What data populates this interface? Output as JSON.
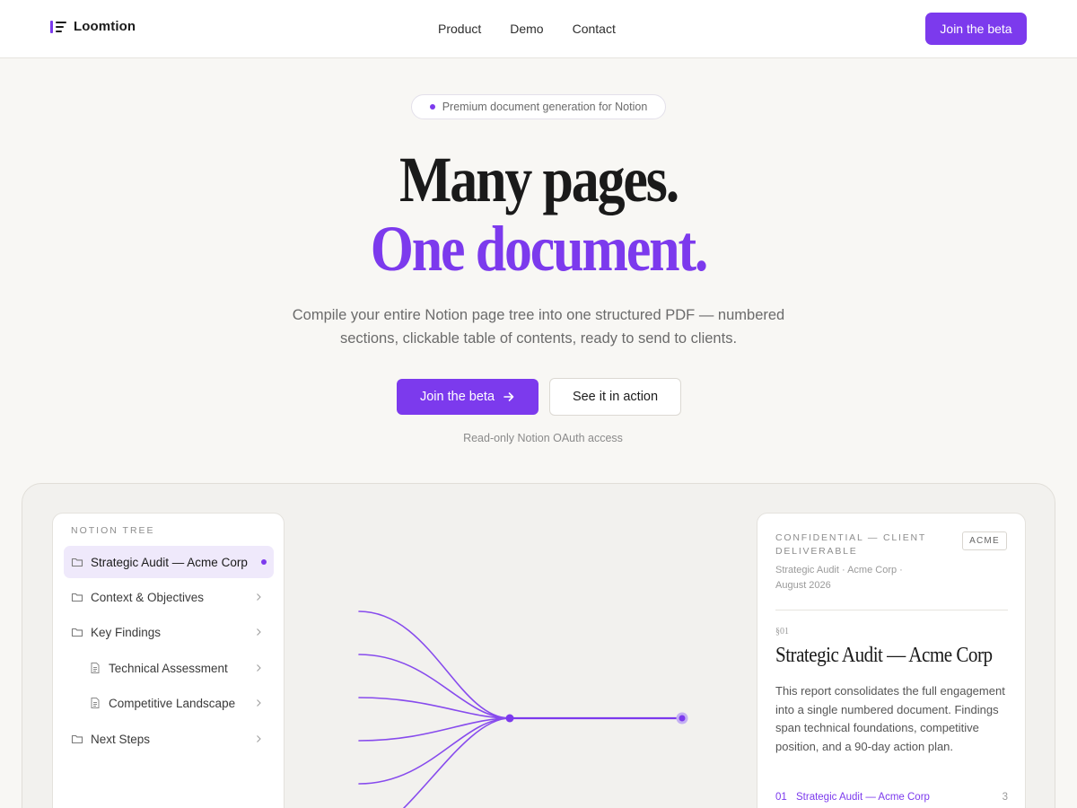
{
  "brand": {
    "name": "Loomtion"
  },
  "nav": {
    "links": [
      "Product",
      "Demo",
      "Contact"
    ],
    "cta": "Join the beta"
  },
  "hero": {
    "pill": "Premium document generation for Notion",
    "title_line1": "Many pages.",
    "title_line2": "One document.",
    "subtitle": "Compile your entire Notion page tree into one structured PDF — numbered sections, clickable table of contents, ready to send to clients.",
    "primary_button": "Join the beta",
    "secondary_button": "See it in action",
    "note": "Read-only Notion OAuth access"
  },
  "tree": {
    "heading": "NOTION TREE",
    "items": [
      {
        "label": "Strategic Audit — Acme Corp",
        "type": "folder",
        "active": true
      },
      {
        "label": "Context & Objectives",
        "type": "folder"
      },
      {
        "label": "Key Findings",
        "type": "folder"
      },
      {
        "label": "Technical Assessment",
        "type": "page",
        "child": true
      },
      {
        "label": "Competitive Landscape",
        "type": "page",
        "child": true
      },
      {
        "label": "Next Steps",
        "type": "folder"
      }
    ]
  },
  "doc": {
    "confidential": "CONFIDENTIAL — CLIENT DELIVERABLE",
    "tag": "ACME",
    "meta": "Strategic Audit · Acme Corp · August 2026",
    "section_number": "§01",
    "title": "Strategic Audit — Acme Corp",
    "body": "This report consolidates the full engagement into a single numbered document. Findings span technical foundations, competitive position, and a 90-day action plan.",
    "toc": [
      {
        "num": "01",
        "title": "Strategic Audit — Acme Corp",
        "page": "3"
      }
    ]
  },
  "colors": {
    "accent": "#7c3aed",
    "background": "#f8f7f4",
    "text": "#1c1c1c"
  }
}
